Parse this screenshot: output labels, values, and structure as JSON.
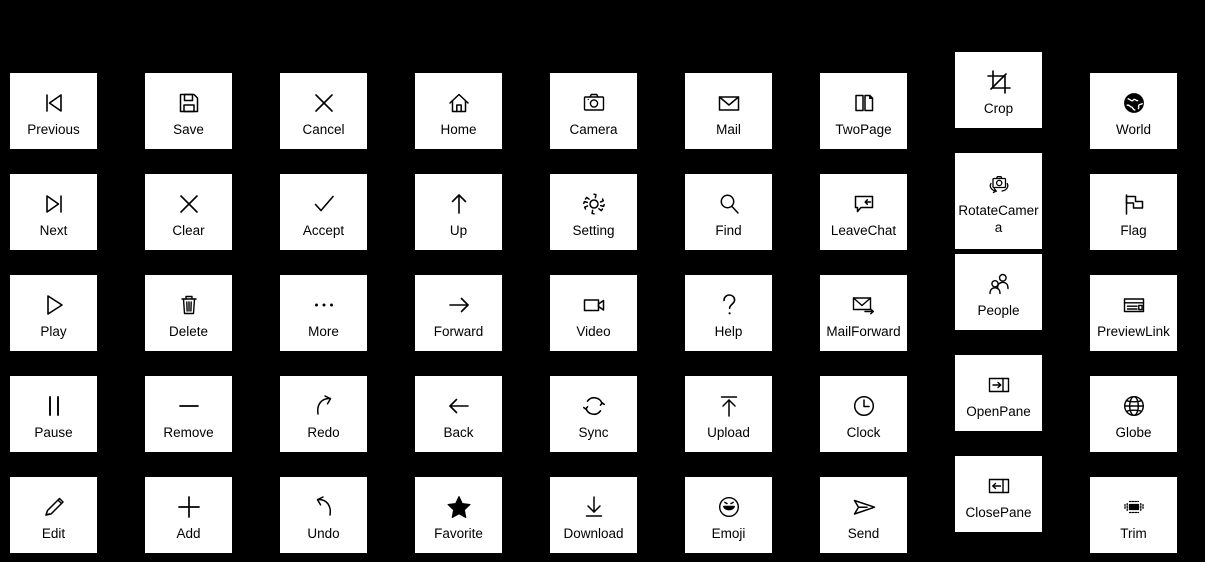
{
  "page": {
    "background_color": "#000000",
    "tile_color": "#ffffff",
    "icon_color": "#000000",
    "label_color": "#000000",
    "columns": 9,
    "rows": 5
  },
  "icons": [
    {
      "label": "Previous",
      "icon": "previous-icon"
    },
    {
      "label": "Save",
      "icon": "save-icon"
    },
    {
      "label": "Cancel",
      "icon": "cancel-icon"
    },
    {
      "label": "Home",
      "icon": "home-icon"
    },
    {
      "label": "Camera",
      "icon": "camera-icon"
    },
    {
      "label": "Mail",
      "icon": "mail-icon"
    },
    {
      "label": "TwoPage",
      "icon": "two-page-icon"
    },
    {
      "label": "Crop",
      "icon": "crop-icon"
    },
    {
      "label": "World",
      "icon": "world-icon"
    },
    {
      "label": "Next",
      "icon": "next-icon"
    },
    {
      "label": "Clear",
      "icon": "clear-icon"
    },
    {
      "label": "Accept",
      "icon": "accept-icon"
    },
    {
      "label": "Up",
      "icon": "up-arrow-icon"
    },
    {
      "label": "Setting",
      "icon": "setting-gear-icon"
    },
    {
      "label": "Find",
      "icon": "find-magnifier-icon"
    },
    {
      "label": "LeaveChat",
      "icon": "leave-chat-icon"
    },
    {
      "label": "RotateCamera",
      "icon": "rotate-camera-icon"
    },
    {
      "label": "Flag",
      "icon": "flag-icon"
    },
    {
      "label": "Play",
      "icon": "play-icon"
    },
    {
      "label": "Delete",
      "icon": "delete-trash-icon"
    },
    {
      "label": "More",
      "icon": "more-ellipsis-icon"
    },
    {
      "label": "Forward",
      "icon": "forward-arrow-icon"
    },
    {
      "label": "Video",
      "icon": "video-camera-icon"
    },
    {
      "label": "Help",
      "icon": "help-question-icon"
    },
    {
      "label": "MailForward",
      "icon": "mail-forward-icon"
    },
    {
      "label": "People",
      "icon": "people-icon"
    },
    {
      "label": "PreviewLink",
      "icon": "preview-link-icon"
    },
    {
      "label": "Pause",
      "icon": "pause-icon"
    },
    {
      "label": "Remove",
      "icon": "remove-dash-icon"
    },
    {
      "label": "Redo",
      "icon": "redo-icon"
    },
    {
      "label": "Back",
      "icon": "back-arrow-icon"
    },
    {
      "label": "Sync",
      "icon": "sync-icon"
    },
    {
      "label": "Upload",
      "icon": "upload-icon"
    },
    {
      "label": "Clock",
      "icon": "clock-icon"
    },
    {
      "label": "OpenPane",
      "icon": "open-pane-icon"
    },
    {
      "label": "Globe",
      "icon": "globe-icon"
    },
    {
      "label": "Edit",
      "icon": "edit-pencil-icon"
    },
    {
      "label": "Add",
      "icon": "add-plus-icon"
    },
    {
      "label": "Undo",
      "icon": "undo-icon"
    },
    {
      "label": "Favorite",
      "icon": "favorite-star-icon"
    },
    {
      "label": "Download",
      "icon": "download-icon"
    },
    {
      "label": "Emoji",
      "icon": "emoji-icon"
    },
    {
      "label": "Send",
      "icon": "send-icon"
    },
    {
      "label": "ClosePane",
      "icon": "close-pane-icon"
    },
    {
      "label": "Trim",
      "icon": "trim-icon"
    }
  ]
}
